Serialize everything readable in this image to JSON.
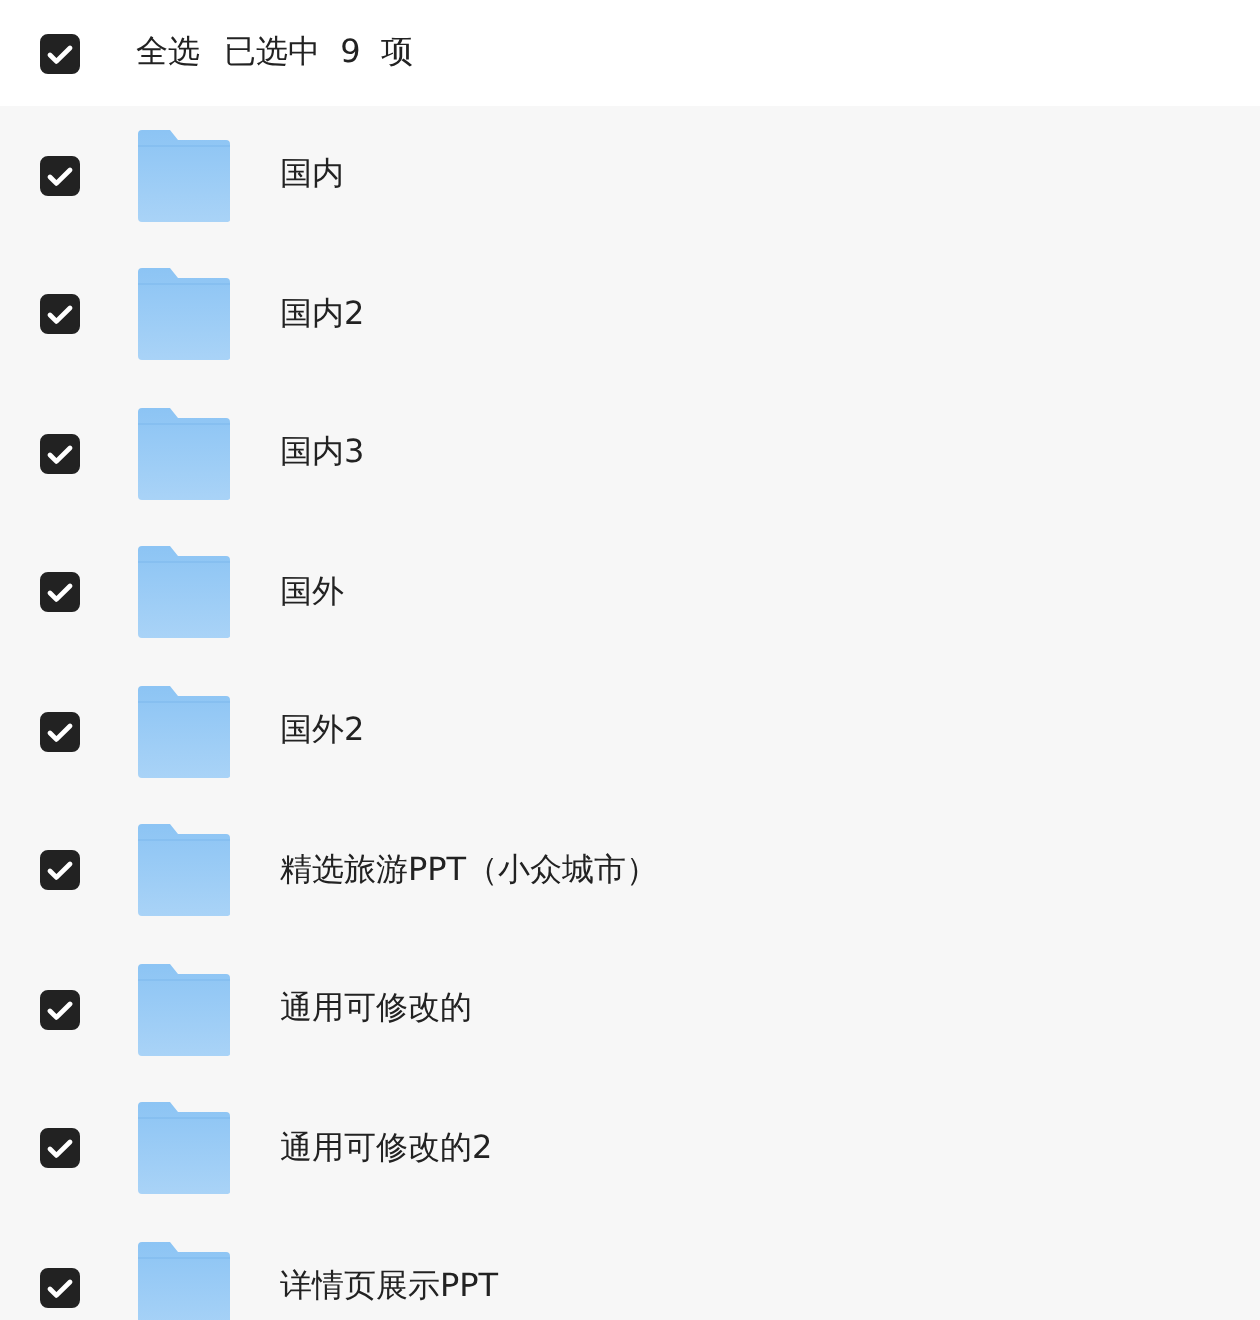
{
  "header": {
    "select_all": {
      "label": "全选",
      "checked": true
    },
    "selection_count": "已选中  9  项"
  },
  "folders": [
    {
      "name": "国内",
      "checked": true
    },
    {
      "name": "国内2",
      "checked": true
    },
    {
      "name": "国内3",
      "checked": true
    },
    {
      "name": "国外",
      "checked": true
    },
    {
      "name": "国外2",
      "checked": true
    },
    {
      "name": "精选旅游PPT（小众城市）",
      "checked": true
    },
    {
      "name": "通用可修改的",
      "checked": true
    },
    {
      "name": "通用可修改的2",
      "checked": true
    },
    {
      "name": "详情页展示PPT",
      "checked": true
    }
  ]
}
